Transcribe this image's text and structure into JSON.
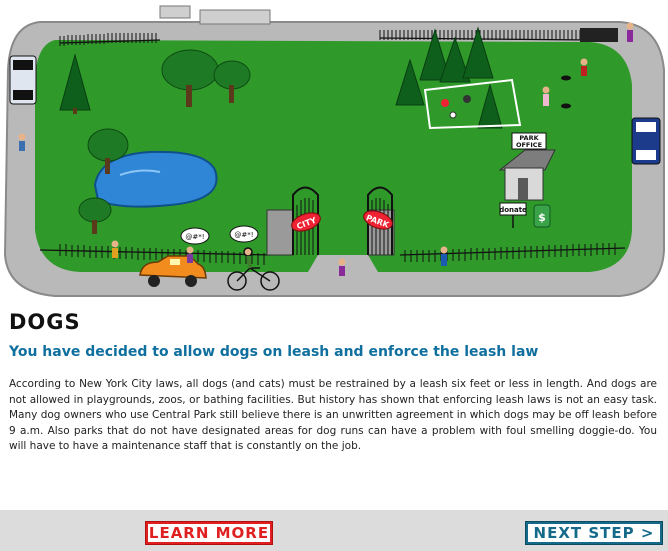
{
  "scene": {
    "gate_left_sign": "CITY",
    "gate_right_sign": "PARK",
    "office_sign_line1": "PARK",
    "office_sign_line2": "OFFICE",
    "donate_sign": "donate",
    "donate_box_symbol": "$",
    "speech_bubble_1": "@#*!",
    "speech_bubble_2": "@#*!",
    "colors": {
      "grass": "#2f9a2a",
      "road": "#b9b9b9",
      "pond": "#2f86d6",
      "car": "#f28c1e"
    }
  },
  "content": {
    "heading": "DOGS",
    "subheading": "You have decided to allow dogs on leash and enforce the leash law",
    "body": "According to New York City laws, all dogs (and cats) must be restrained by a leash six feet or less in length. And dogs are not allowed in playgrounds, zoos, or bathing facilities. But history has shown that enforcing leash laws is not an easy task. Many dog owners who use Central Park still believe there is an unwritten agreement in which dogs may be off leash before 9 a.m. Also parks that do not have designated areas for dog runs can have a problem with foul smelling doggie-do. You will have to have a maintenance staff that is constantly on the job."
  },
  "footer": {
    "learn_more_label": "LEARN MORE",
    "next_step_label": "NEXT STEP >"
  }
}
